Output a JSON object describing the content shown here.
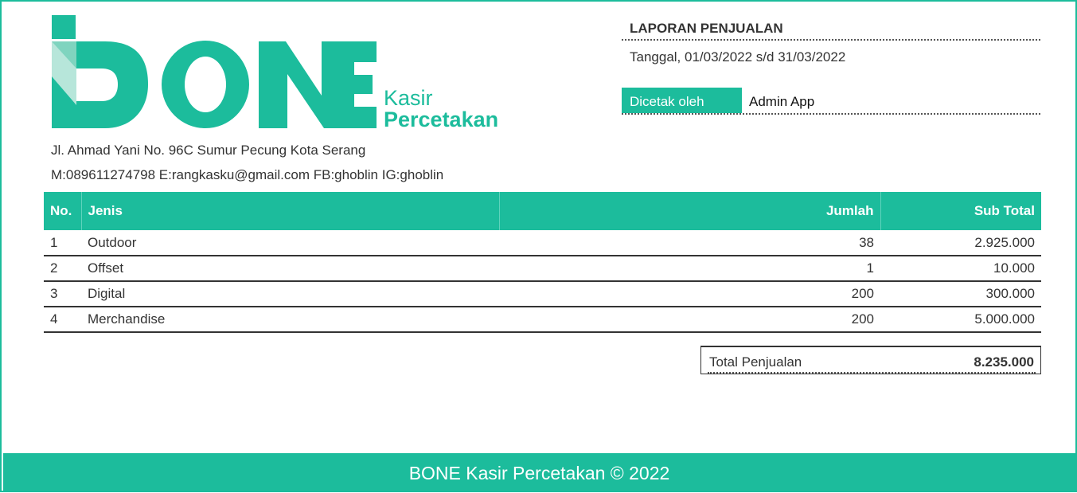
{
  "brand": {
    "logo_wordmark": "BONE",
    "logo_line1": "Kasir",
    "logo_line2": "Percetakan",
    "primary_color": "#1cbc9c",
    "dark_color": "#179a80"
  },
  "company": {
    "address": "Jl. Ahmad Yani No. 96C Sumur Pecung Kota Serang",
    "contacts": "M:089611274798 E:rangkasku@gmail.com FB:ghoblin IG:ghoblin"
  },
  "report": {
    "title": "LAPORAN PENJUALAN",
    "date_range": "Tanggal, 01/03/2022 s/d 31/03/2022",
    "printed_by_label": "Dicetak oleh",
    "printed_by_value": "Admin App"
  },
  "table": {
    "headers": {
      "no": "No.",
      "jenis": "Jenis",
      "jumlah": "Jumlah",
      "subtotal": "Sub Total"
    },
    "rows": [
      {
        "no": "1",
        "jenis": "Outdoor",
        "jumlah": "38",
        "subtotal": "2.925.000"
      },
      {
        "no": "2",
        "jenis": "Offset",
        "jumlah": "1",
        "subtotal": "10.000"
      },
      {
        "no": "3",
        "jenis": "Digital",
        "jumlah": "200",
        "subtotal": "300.000"
      },
      {
        "no": "4",
        "jenis": "Merchandise",
        "jumlah": "200",
        "subtotal": "5.000.000"
      }
    ]
  },
  "total": {
    "label": "Total Penjualan",
    "value": "8.235.000"
  },
  "footer": {
    "text": "BONE Kasir Percetakan © 2022"
  }
}
